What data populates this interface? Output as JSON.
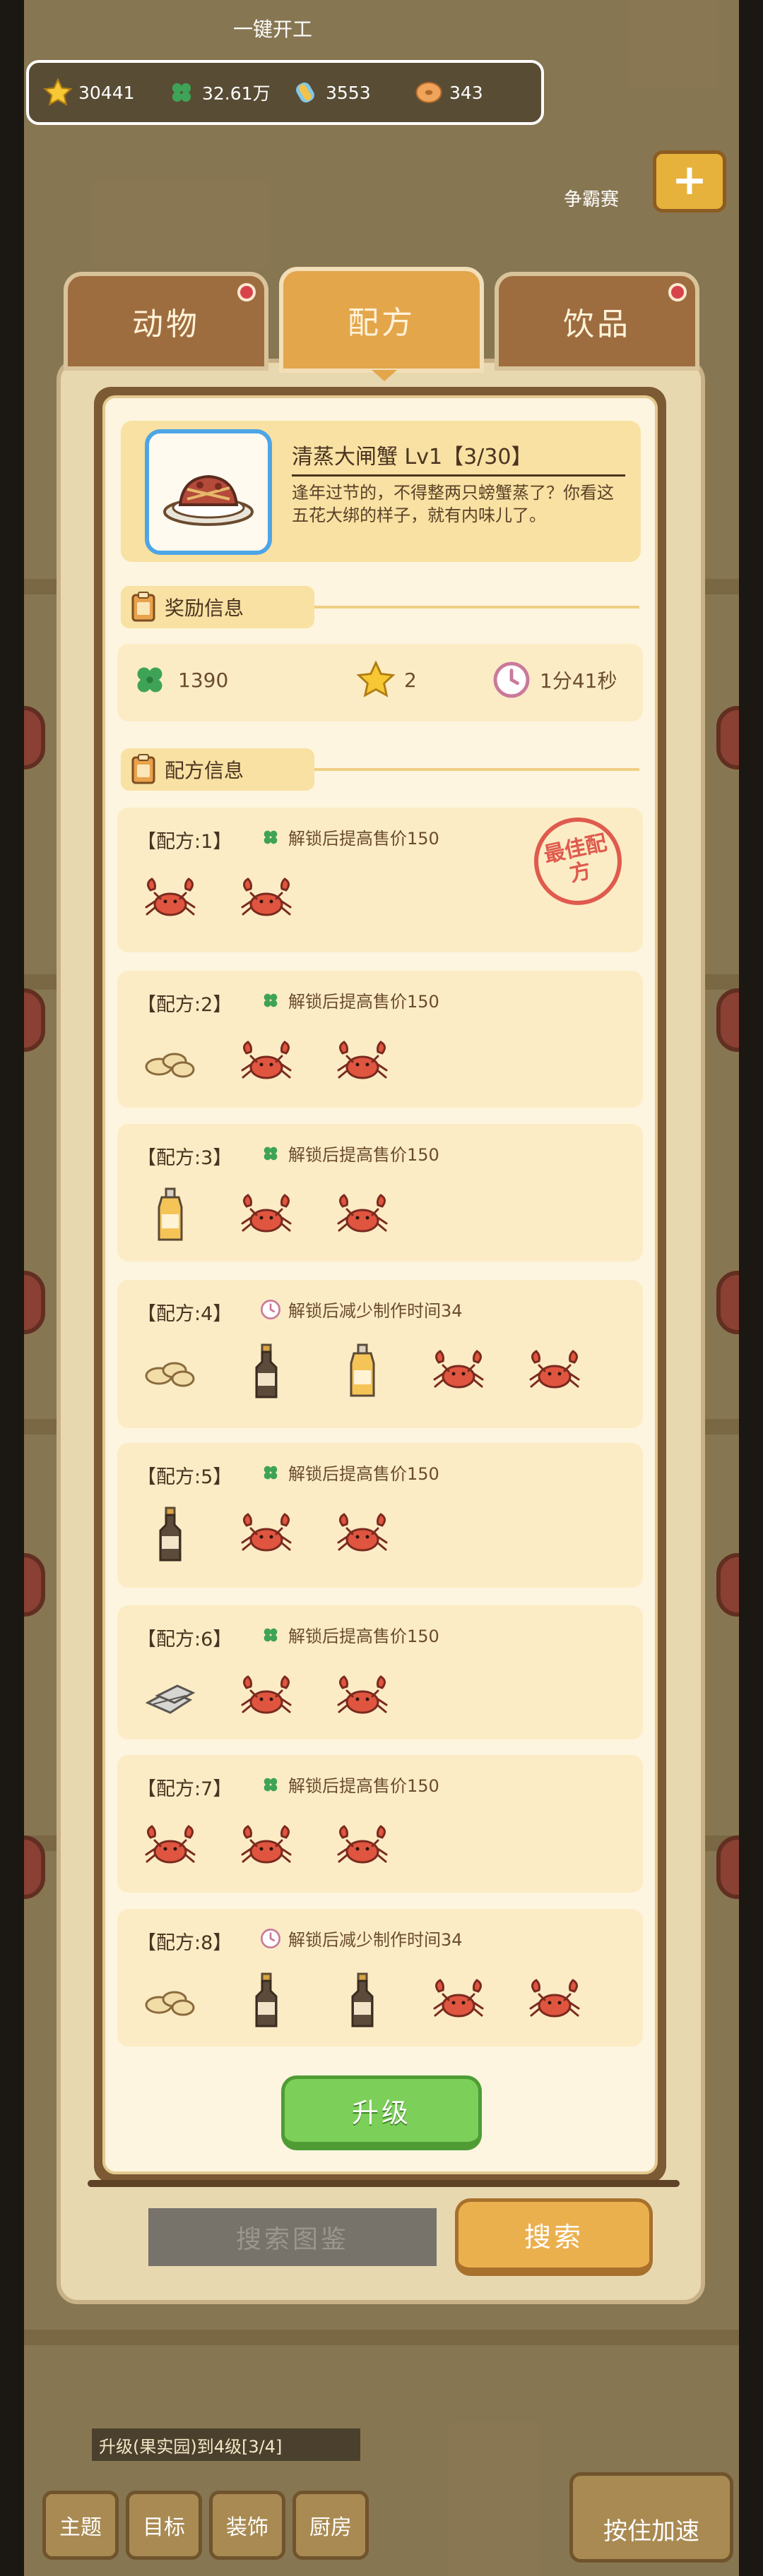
{
  "top": {
    "faded_label": "一键开工"
  },
  "resources": [
    {
      "icon": "star-icon",
      "value": "30441"
    },
    {
      "icon": "clover-icon",
      "value": "32.61万"
    },
    {
      "icon": "candy-icon",
      "value": "3553"
    },
    {
      "icon": "donut-coin-icon",
      "value": "343"
    }
  ],
  "side": {
    "label": "争霸赛",
    "plus": "+"
  },
  "tabs": [
    {
      "label": "动物",
      "active": false,
      "badge": true
    },
    {
      "label": "配方",
      "active": true,
      "badge": false
    },
    {
      "label": "饮品",
      "active": false,
      "badge": true
    }
  ],
  "recipe": {
    "title": "清蒸大闸蟹 Lv1【3/30】",
    "description": "逢年过节的，不得整两只螃蟹蒸了？你看这五花大绑的样子，就有内味儿了。"
  },
  "reward_section": {
    "title": "奖励信息",
    "clover": "1390",
    "star": "2",
    "time": "1分41秒"
  },
  "formula_section": {
    "title": "配方信息"
  },
  "formulas": [
    {
      "label": "【配方:1】",
      "note_icon": "clover-icon",
      "note": "解锁后提高售价150",
      "best": true,
      "ingredients": [
        "crab",
        "crab"
      ]
    },
    {
      "label": "【配方:2】",
      "note_icon": "clover-icon",
      "note": "解锁后提高售价150",
      "best": false,
      "ingredients": [
        "ginger",
        "crab",
        "crab"
      ]
    },
    {
      "label": "【配方:3】",
      "note_icon": "clover-icon",
      "note": "解锁后提高售价150",
      "best": false,
      "ingredients": [
        "oil-bottle",
        "crab",
        "crab"
      ]
    },
    {
      "label": "【配方:4】",
      "note_icon": "clock-icon",
      "note": "解锁后减少制作时间34",
      "best": false,
      "ingredients": [
        "ginger",
        "soy-bottle",
        "oil-bottle",
        "crab",
        "crab"
      ]
    },
    {
      "label": "【配方:5】",
      "note_icon": "clover-icon",
      "note": "解锁后提高售价150",
      "best": false,
      "ingredients": [
        "soy-bottle",
        "crab",
        "crab"
      ]
    },
    {
      "label": "【配方:6】",
      "note_icon": "clover-icon",
      "note": "解锁后提高售价150",
      "best": false,
      "ingredients": [
        "rope",
        "crab",
        "crab"
      ]
    },
    {
      "label": "【配方:7】",
      "note_icon": "clover-icon",
      "note": "解锁后提高售价150",
      "best": false,
      "ingredients": [
        "crab",
        "crab",
        "crab"
      ]
    },
    {
      "label": "【配方:8】",
      "note_icon": "clock-icon",
      "note": "解锁后减少制作时间34",
      "best": false,
      "ingredients": [
        "ginger",
        "soy-bottle",
        "soy-bottle",
        "crab",
        "crab"
      ]
    }
  ],
  "best_stamp": "最佳配方",
  "upgrade_label": "升级",
  "search": {
    "placeholder": "搜索图鉴",
    "button": "搜索"
  },
  "bottom": {
    "info": "升级(果实园)到4级[3/4]",
    "nav": [
      "主题",
      "目标",
      "装饰",
      "厨房"
    ],
    "speed": "按住加速"
  },
  "colors": {
    "accent": "#e4a64b",
    "panel": "#fdf5df",
    "upgrade": "#7ccf58",
    "crab": "#e0553f"
  }
}
